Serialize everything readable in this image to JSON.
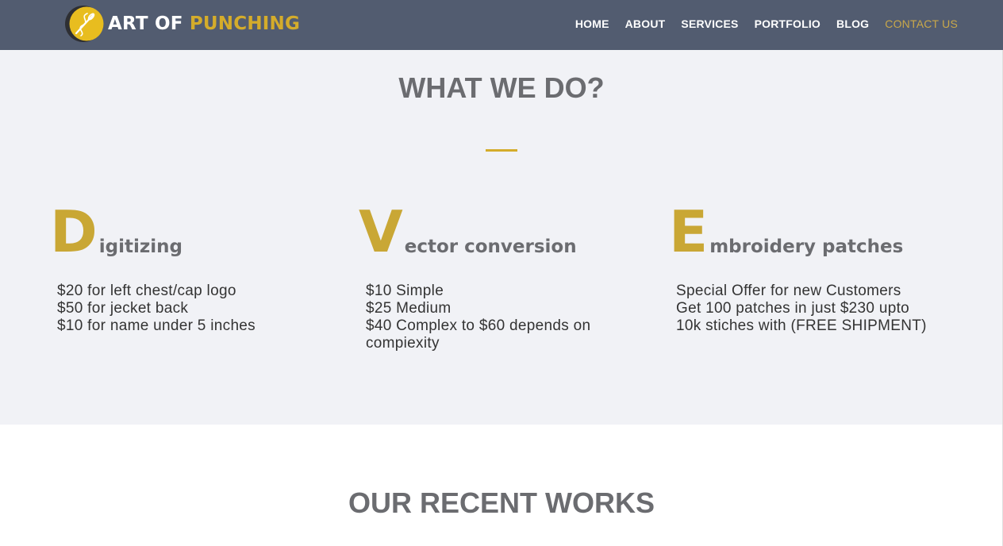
{
  "header": {
    "logo": {
      "word1": "ART OF",
      "word2": "PUNCHING"
    },
    "nav": [
      {
        "label": "HOME",
        "active": false
      },
      {
        "label": "ABOUT",
        "active": false
      },
      {
        "label": "SERVICES",
        "active": false
      },
      {
        "label": "PORTFOLIO",
        "active": false
      },
      {
        "label": "BLOG",
        "active": false
      },
      {
        "label": "CONTACT US",
        "active": true
      }
    ]
  },
  "what_we_do": {
    "title": "WHAT WE DO?",
    "columns": [
      {
        "letter": "D",
        "title_rest": "igitizing",
        "lines": [
          "$20 for left chest/cap logo",
          "$50 for jecket back",
          "$10 for name under 5 inches"
        ]
      },
      {
        "letter": "V",
        "title_rest": "ector conversion",
        "lines": [
          "$10 Simple",
          "$25 Medium",
          "$40 Complex to $60 depends on",
          "compiexity"
        ]
      },
      {
        "letter": "E",
        "title_rest": "mbroidery patches",
        "lines": [
          "Special Offer for new Customers",
          "Get 100 patches in just $230 upto",
          "10k stiches with (FREE SHIPMENT)"
        ]
      }
    ]
  },
  "recent_works": {
    "title": "OUR RECENT WORKS"
  },
  "colors": {
    "header_bg": "#525c70",
    "accent": "#d4ac2b",
    "section_bg": "#f1f2f6",
    "heading": "#6b6c70"
  },
  "icons": {
    "logo": "needle-thread-logo-icon"
  }
}
